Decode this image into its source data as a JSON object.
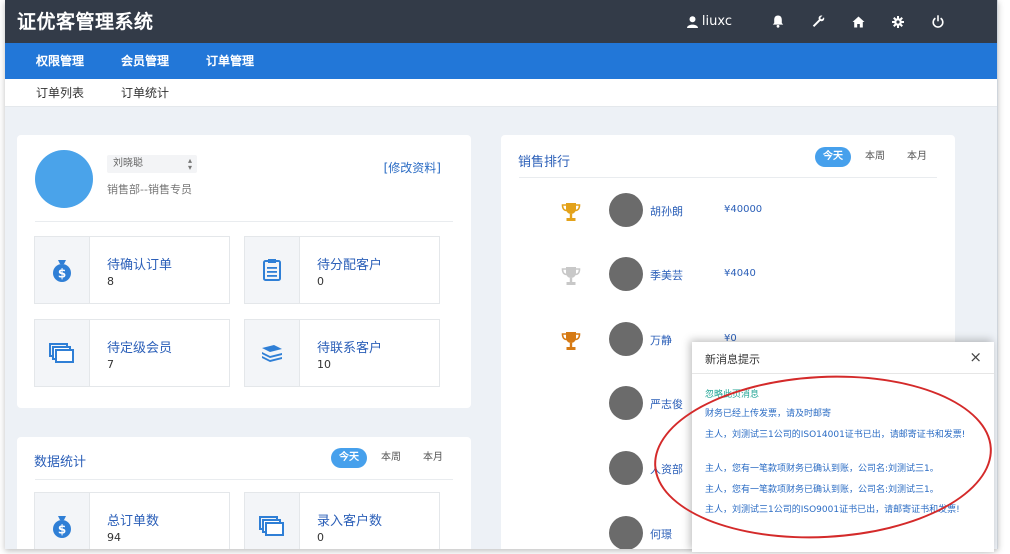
{
  "app": {
    "title": "证优客管理系统"
  },
  "topbar": {
    "username": "liuxc",
    "icons": [
      "user-icon",
      "bell-icon",
      "wrench-icon",
      "home-icon",
      "gear-icon",
      "power-icon"
    ]
  },
  "nav": {
    "items": [
      "权限管理",
      "会员管理",
      "订单管理"
    ]
  },
  "subnav": {
    "items": [
      "订单列表",
      "订单统计"
    ]
  },
  "profile": {
    "name": "刘晓聪",
    "department": "销售部--销售专员",
    "edit_label": "[修改资料]",
    "avatar_color": "#4aa3ea"
  },
  "stats": [
    {
      "label": "待确认订单",
      "value": "8",
      "icon": "money-bag-icon"
    },
    {
      "label": "待分配客户",
      "value": "0",
      "icon": "clipboard-list-icon"
    },
    {
      "label": "待定级会员",
      "value": "7",
      "icon": "cards-icon"
    },
    {
      "label": "待联系客户",
      "value": "10",
      "icon": "stack-icon"
    }
  ],
  "data_stats": {
    "title": "数据统计",
    "tabs": [
      "今天",
      "本周",
      "本月"
    ],
    "active_tab": "今天",
    "items": [
      {
        "label": "总订单数",
        "value": "94",
        "icon": "money-bag-icon"
      },
      {
        "label": "录入客户数",
        "value": "0",
        "icon": "cards-icon"
      }
    ]
  },
  "ranking": {
    "title": "销售排行",
    "tabs": [
      "今天",
      "本周",
      "本月"
    ],
    "active_tab": "今天",
    "rows": [
      {
        "name": "胡孙朗",
        "amount": "¥40000",
        "trophy": "gold"
      },
      {
        "name": "季美芸",
        "amount": "¥4040",
        "trophy": "silver"
      },
      {
        "name": "万静",
        "amount": "¥0",
        "trophy": "bronze"
      },
      {
        "name": "严志俊",
        "amount": "",
        "trophy": ""
      },
      {
        "name": "人资部",
        "amount": "",
        "trophy": ""
      },
      {
        "name": "何璟",
        "amount": "",
        "trophy": ""
      }
    ]
  },
  "popup": {
    "title": "新消息提示",
    "close": "×",
    "ignore": "忽略此页消息",
    "messages": [
      "财务已经上传发票，请及时邮寄",
      "主人，刘测试三1公司的ISO14001证书已出，请邮寄证书和发票!",
      "主人，您有一笔款项财务已确认到账，公司名:刘测试三1。",
      "主人，您有一笔款项财务已确认到账，公司名:刘测试三1。",
      "主人，刘测试三1公司的ISO9001证书已出，请邮寄证书和发票!"
    ]
  },
  "colors": {
    "topbar": "#333b48",
    "navbar": "#2277d8",
    "accent": "#46a0ec",
    "link": "#2b5fb8",
    "annotation": "#d42a2a"
  }
}
